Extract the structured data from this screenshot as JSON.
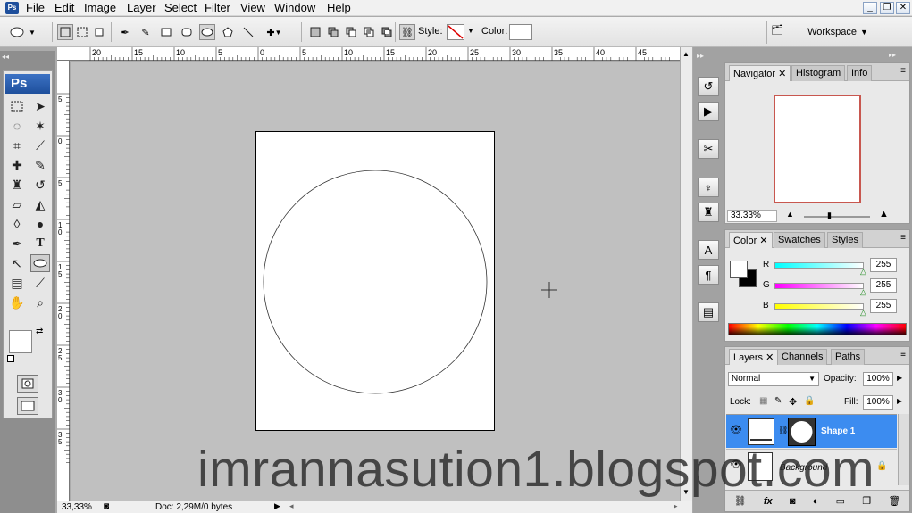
{
  "menubar": {
    "app_icon": "Ps",
    "items": [
      "File",
      "Edit",
      "Image",
      "Layer",
      "Select",
      "Filter",
      "View",
      "Window",
      "Help"
    ],
    "window_controls": [
      "minimize-icon",
      "restore-icon",
      "close-icon"
    ]
  },
  "optionsbar": {
    "style_label": "Style:",
    "color_label": "Color:",
    "workspace_label": "Workspace"
  },
  "rulers": {
    "horizontal": [
      "20",
      "15",
      "10",
      "5",
      "0",
      "5",
      "10",
      "15",
      "20",
      "25",
      "30",
      "35",
      "40",
      "45"
    ],
    "vertical": [
      "5",
      "0",
      "5",
      "10",
      "15",
      "20",
      "25",
      "30",
      "35"
    ]
  },
  "status": {
    "zoom": "33,33%",
    "doc_info": "Doc: 2,29M/0 bytes"
  },
  "toolbox": {
    "logo": "Ps"
  },
  "navigator": {
    "tabs": [
      "Navigator",
      "Histogram",
      "Info"
    ],
    "zoom": "33.33%"
  },
  "color_panel": {
    "tabs": [
      "Color",
      "Swatches",
      "Styles"
    ],
    "channels": [
      {
        "label": "R",
        "value": "255"
      },
      {
        "label": "G",
        "value": "255"
      },
      {
        "label": "B",
        "value": "255"
      }
    ]
  },
  "layers_panel": {
    "tabs": [
      "Layers",
      "Channels",
      "Paths"
    ],
    "blend_mode": "Normal",
    "opacity_label": "Opacity:",
    "opacity": "100%",
    "lock_label": "Lock:",
    "fill_label": "Fill:",
    "fill": "100%",
    "layers": [
      {
        "name": "Shape 1",
        "selected": true
      },
      {
        "name": "Background",
        "selected": false
      }
    ]
  },
  "watermark": "imrannasution1.blogspot.com",
  "colors": {
    "selection_blue": "#3c8cf0",
    "canvas_gray": "#c0c0c0",
    "ps_blue": "#1e4f9c"
  }
}
